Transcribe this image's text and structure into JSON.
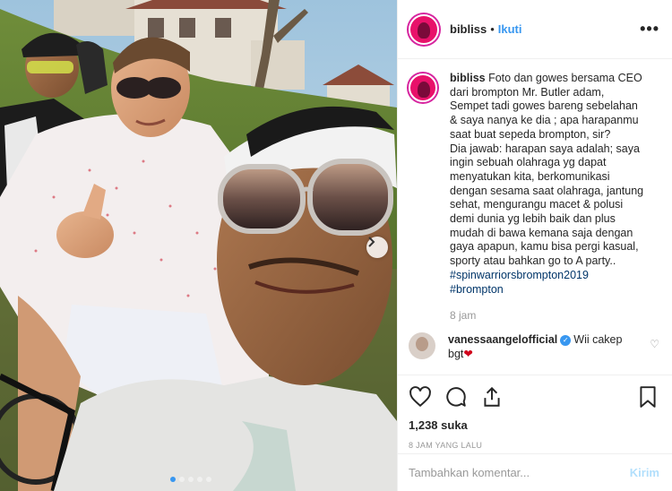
{
  "photo": {
    "alt_icon": "carousel-next-icon",
    "slides": 5,
    "active_slide": 1
  },
  "post": {
    "username": "bibliss",
    "separator": "•",
    "follow_label": "Ikuti",
    "more_label": "•••",
    "caption_lines": [
      "Foto dan gowes bersama CEO",
      "dari brompton Mr. Butler adam,",
      "Sempet tadi gowes bareng sebelahan",
      "& saya nanya ke dia ; apa harapanmu",
      "saat buat sepeda brompton, sir?",
      "Dia jawab: harapan saya adalah; saya",
      "ingin sebuah olahraga yg dapat",
      "menyatukan kita, berkomunikasi",
      "dengan sesama saat olahraga, jantung",
      "sehat, mengurangu macet & polusi",
      "demi dunia yg lebih baik dan plus",
      "mudah di bawa kemana saja dengan",
      "gaya apapun, kamu bisa pergi kasual,",
      "sporty atau bahkan go to A party.."
    ],
    "hashtags": [
      "#spinwarriorsbrompton2019",
      "#brompton"
    ],
    "caption_time": "8 jam",
    "comment": {
      "username": "vanessaangelofficial",
      "text_line1": "Wii cakep",
      "text_line2": "bgt",
      "emoji": "❤"
    },
    "likes": "1,238 suka",
    "time_ago": "8 JAM YANG LALU",
    "comment_placeholder": "Tambahkan komentar...",
    "post_label": "Kirim"
  },
  "colors": {
    "link_blue": "#3897f0",
    "hashtag": "#003569",
    "muted": "#999999",
    "border": "#efefef"
  }
}
